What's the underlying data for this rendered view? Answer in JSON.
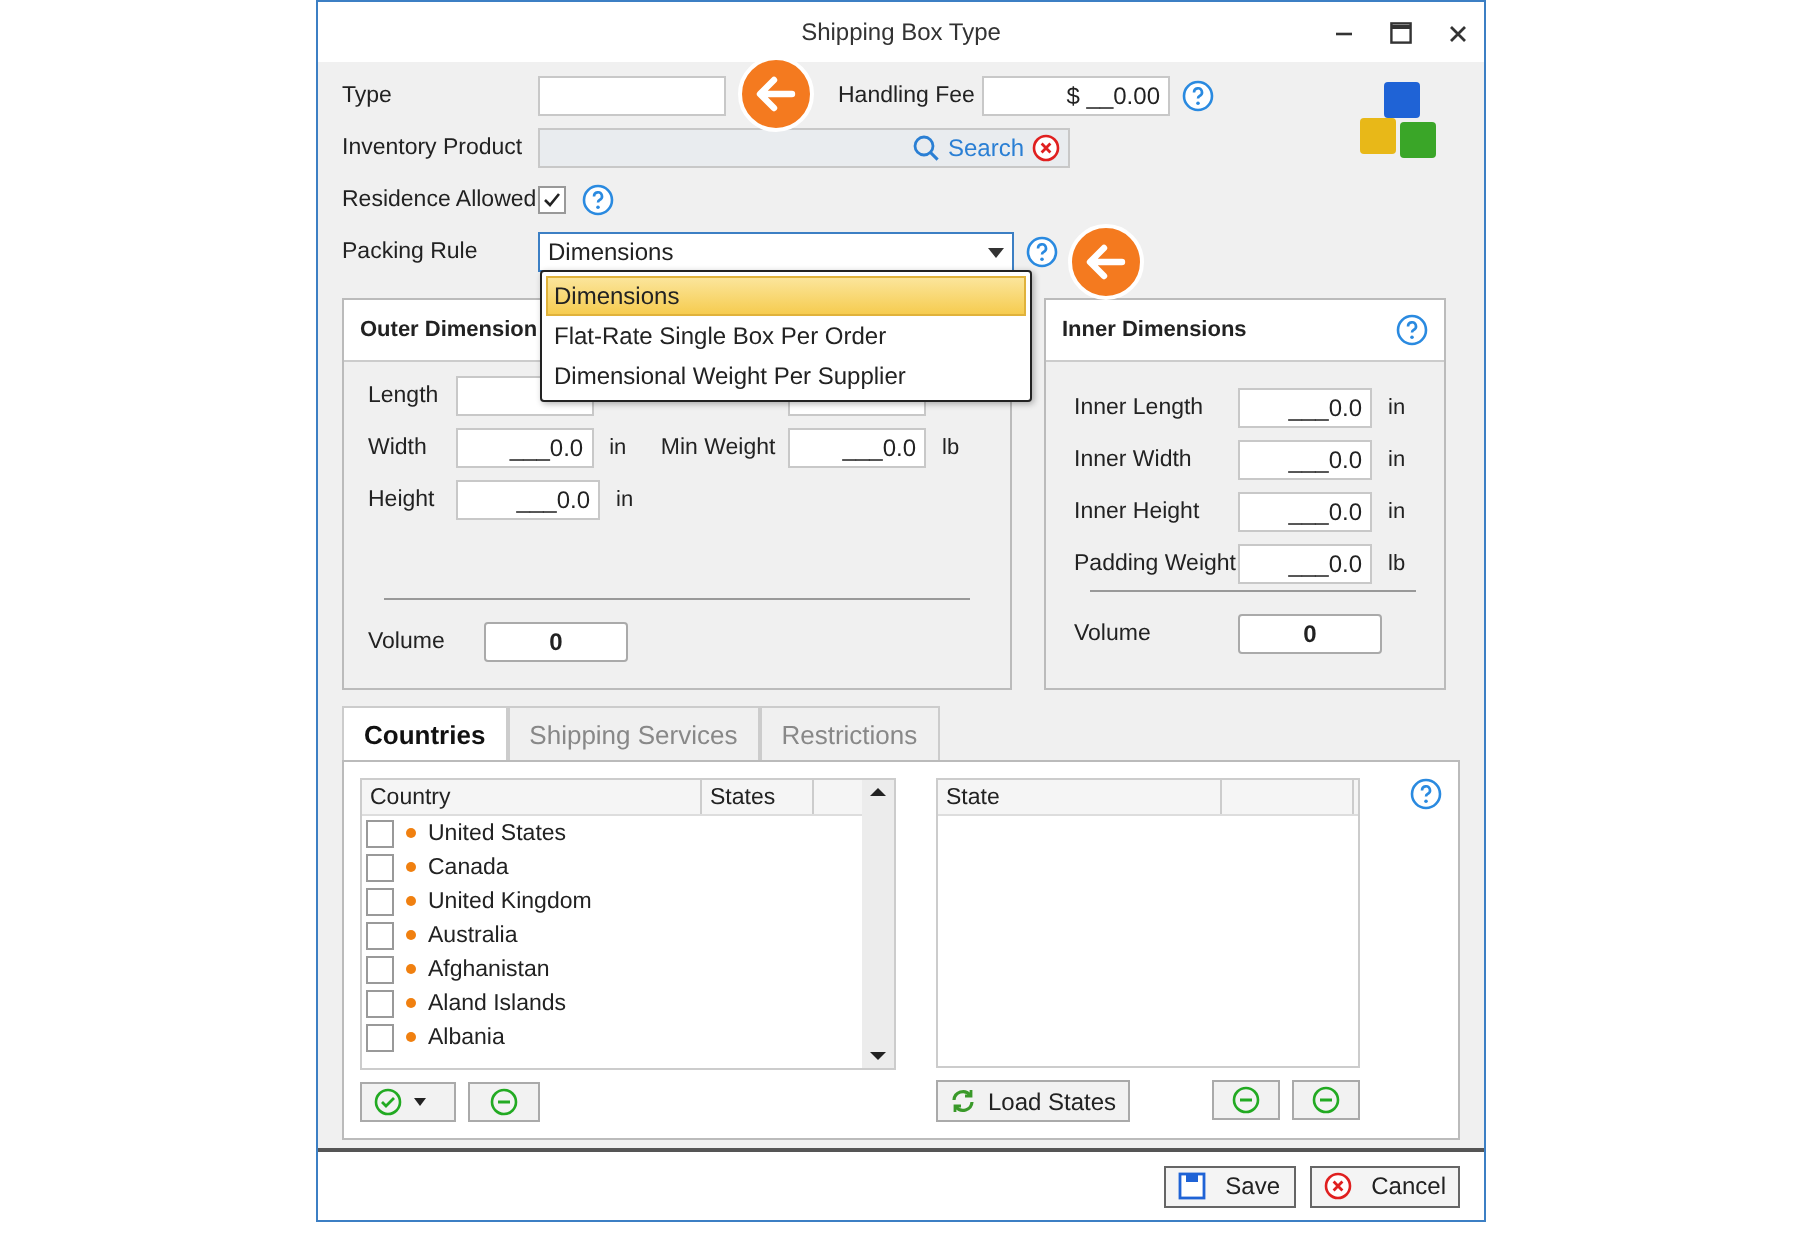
{
  "window": {
    "title": "Shipping Box Type"
  },
  "form": {
    "type": {
      "label": "Type"
    },
    "handling_fee": {
      "label": "Handling Fee",
      "value": "$ __0.00"
    },
    "inventory_product": {
      "label": "Inventory Product",
      "search_label": "Search"
    },
    "residence_allowed": {
      "label": "Residence Allowed",
      "checked": true
    },
    "packing_rule": {
      "label": "Packing Rule",
      "value": "Dimensions",
      "expanded": true,
      "options": [
        {
          "label": "Dimensions",
          "selected": true
        },
        {
          "label": "Flat-Rate Single Box Per Order",
          "selected": false
        },
        {
          "label": "Dimensional Weight Per Supplier",
          "selected": false
        }
      ]
    }
  },
  "outer_dimensions": {
    "title": "Outer Dimension",
    "rows": [
      {
        "left": {
          "label": "Length"
        },
        "right": {}
      },
      {
        "left": {
          "label": "Width",
          "value": "___0.0",
          "unit": "in"
        },
        "right": {
          "label": "Min Weight",
          "value": "___0.0",
          "unit": "lb"
        }
      },
      {
        "left": {
          "label": "Height",
          "value": "___0.0",
          "unit": "in"
        }
      }
    ],
    "volume": {
      "label": "Volume",
      "value": "0"
    }
  },
  "inner_dimensions": {
    "title": "Inner Dimensions",
    "fields": [
      {
        "label": "Inner Length",
        "value": "___0.0",
        "unit": "in"
      },
      {
        "label": "Inner Width",
        "value": "___0.0",
        "unit": "in"
      },
      {
        "label": "Inner Height",
        "value": "___0.0",
        "unit": "in"
      },
      {
        "label": "Padding Weight",
        "value": "___0.0",
        "unit": "lb"
      }
    ],
    "volume": {
      "label": "Volume",
      "value": "0"
    }
  },
  "tabs": [
    {
      "label": "Countries",
      "selected": true
    },
    {
      "label": "Shipping Services",
      "selected": false
    },
    {
      "label": "Restrictions",
      "selected": false
    }
  ],
  "countries_table": {
    "columns": [
      "Country",
      "States"
    ],
    "rows": [
      {
        "name": "United States",
        "checked": false
      },
      {
        "name": "Canada",
        "checked": false
      },
      {
        "name": "United Kingdom",
        "checked": false
      },
      {
        "name": "Australia",
        "checked": false
      },
      {
        "name": "Afghanistan",
        "checked": false
      },
      {
        "name": "Aland Islands",
        "checked": false
      },
      {
        "name": "Albania",
        "checked": false
      }
    ]
  },
  "states_table": {
    "columns": [
      "State"
    ]
  },
  "load_states_button": "Load States",
  "footer": {
    "buttons": [
      {
        "label": "Save",
        "kind": "save"
      },
      {
        "label": "Cancel",
        "kind": "cancel"
      }
    ]
  }
}
